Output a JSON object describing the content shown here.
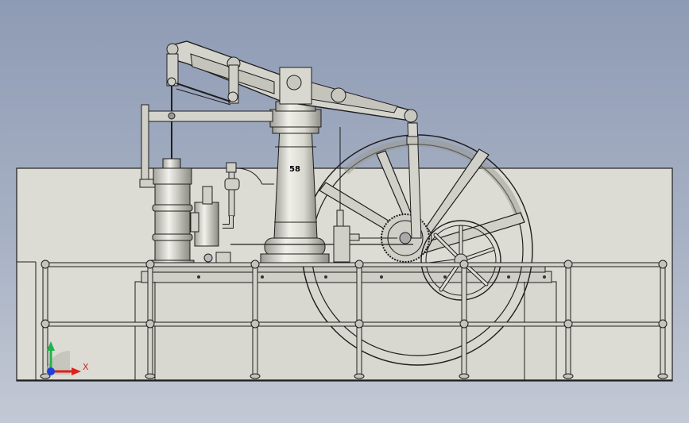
{
  "viewport": {
    "background_top": "#8e9bb4",
    "background_bottom": "#c3c9d4"
  },
  "model": {
    "body_color": "#dcdcd4",
    "part_color": "#d2d2ca",
    "edge_color": "#1e1e1e",
    "shade_color": "#9a9a92"
  },
  "cylinder_stamp": "58",
  "triad": {
    "x_label": "X",
    "x_color": "#e0201a",
    "y_color": "#22b14c",
    "z_color": "#1f3fd6",
    "origin_icon": "axis-triad-icon"
  }
}
